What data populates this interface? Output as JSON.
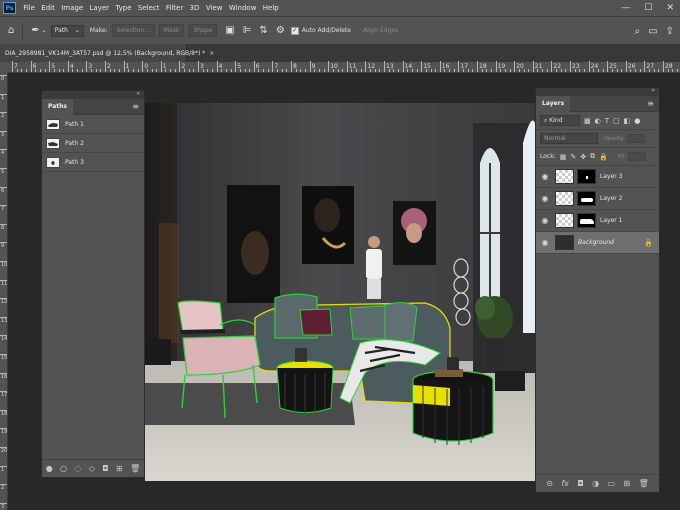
{
  "app": {
    "logo": "Ps",
    "menu": [
      "File",
      "Edit",
      "Image",
      "Layer",
      "Type",
      "Select",
      "Filter",
      "3D",
      "View",
      "Window",
      "Help"
    ],
    "window_controls": [
      "—",
      "☐",
      "✕"
    ]
  },
  "options_bar": {
    "tool_mode": "Path",
    "make_label": "Make:",
    "selection_button": "Selection...",
    "mask_button": "Mask",
    "shape_button": "Shape",
    "auto_add_delete_label": "Auto Add/Delete",
    "auto_add_delete_checked": true,
    "align_edges_label": "Align Edges"
  },
  "document_tab": {
    "title": "DIA_2958981_VK14M_3AT57.psd @ 12,5% (Background, RGB/8*) *",
    "close": "×"
  },
  "rulers": {
    "top_labels": [
      "7",
      "6",
      "5",
      "4",
      "3",
      "2",
      "1",
      "0",
      "1",
      "2",
      "3",
      "4",
      "5",
      "6",
      "7",
      "8",
      "9",
      "10",
      "11",
      "12",
      "13",
      "14",
      "15",
      "16",
      "17",
      "18",
      "19",
      "20",
      "21",
      "22",
      "23",
      "24",
      "25",
      "26",
      "27",
      "28"
    ],
    "left_labels": [
      "0",
      "1",
      "2",
      "3",
      "4",
      "5",
      "6",
      "7",
      "8",
      "9",
      "10",
      "11",
      "12",
      "13",
      "14",
      "15",
      "16",
      "17",
      "18",
      "19",
      "20",
      "1",
      "2",
      "3"
    ]
  },
  "paths_panel": {
    "title": "Paths",
    "items": [
      {
        "name": "Path 1"
      },
      {
        "name": "Path 2"
      },
      {
        "name": "Path 3"
      }
    ]
  },
  "layers_panel": {
    "title": "Layers",
    "filter_kind": "Kind",
    "blend_mode": "Normal",
    "opacity_label": "Opacity:",
    "lock_label": "Lock:",
    "fill_label": "Fill:",
    "layers": [
      {
        "name": "Layer 3",
        "selected": false
      },
      {
        "name": "Layer 2",
        "selected": false
      },
      {
        "name": "Layer 1",
        "selected": false
      },
      {
        "name": "Background",
        "selected": true,
        "locked": true
      }
    ]
  },
  "colors": {
    "ui_panel": "#535353",
    "ui_dark": "#282828",
    "selection_green": "#2bd23a",
    "selection_yellow": "#e8e000"
  }
}
